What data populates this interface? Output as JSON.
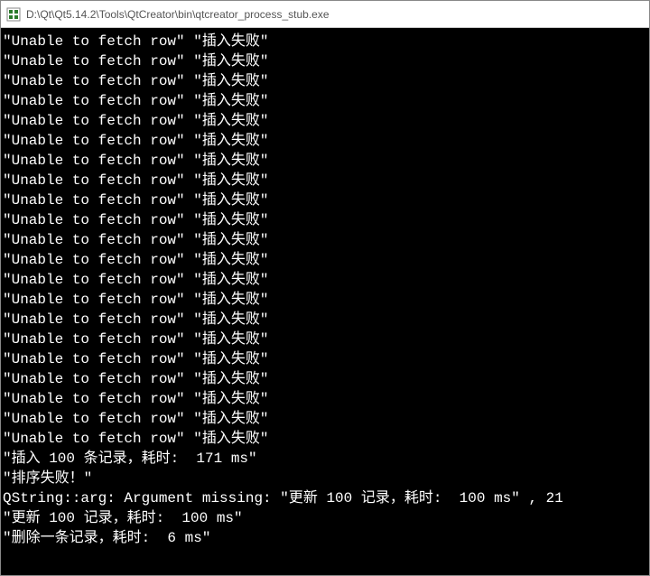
{
  "window": {
    "title": "D:\\Qt\\Qt5.14.2\\Tools\\QtCreator\\bin\\qtcreator_process_stub.exe"
  },
  "console": {
    "repeated_line": "\"Unable to fetch row\" \"插入失败\"",
    "repeat_count": 21,
    "tail_lines": [
      "\"插入 100 条记录，耗时:  171 ms\"",
      "\"排序失败！\"",
      "QString::arg: Argument missing: \"更新 100 记录，耗时:  100 ms\" , 21",
      "\"更新 100 记录，耗时:  100 ms\"",
      "\"删除一条记录，耗时:  6 ms\""
    ]
  }
}
